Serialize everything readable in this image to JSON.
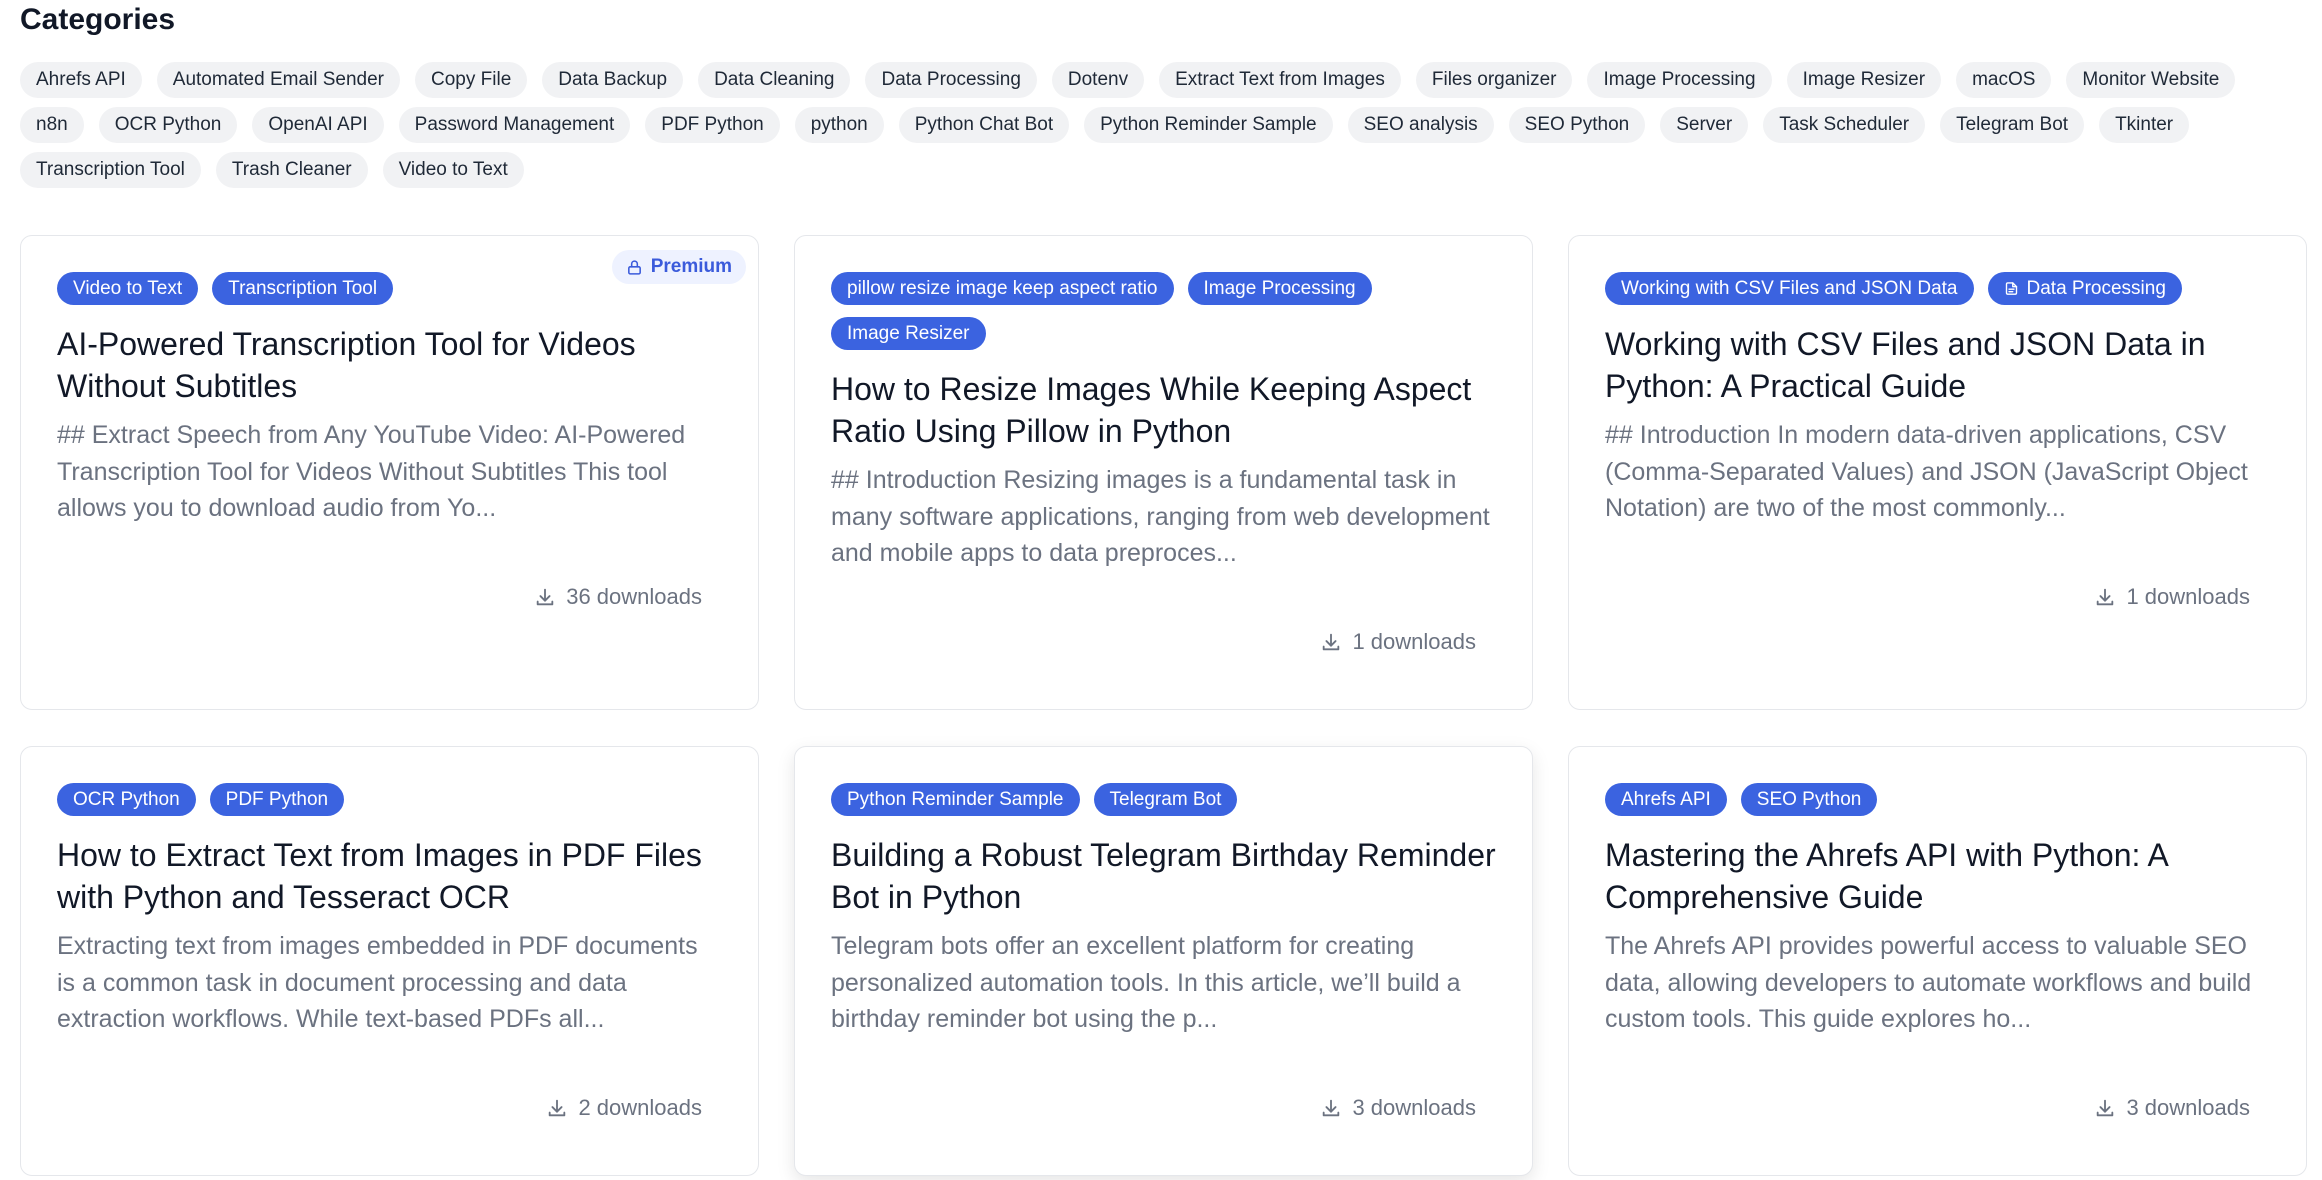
{
  "categories": {
    "title": "Categories",
    "items": [
      "Ahrefs API",
      "Automated Email Sender",
      "Copy File",
      "Data Backup",
      "Data Cleaning",
      "Data Processing",
      "Dotenv",
      "Extract Text from Images",
      "Files organizer",
      "Image Processing",
      "Image Resizer",
      "macOS",
      "Monitor Website",
      "n8n",
      "OCR Python",
      "OpenAI API",
      "Password Management",
      "PDF Python",
      "python",
      "Python Chat Bot",
      "Python Reminder Sample",
      "SEO analysis",
      "SEO Python",
      "Server",
      "Task Scheduler",
      "Telegram Bot",
      "Tkinter",
      "Transcription Tool",
      "Trash Cleaner",
      "Video to Text"
    ]
  },
  "cards": [
    {
      "tags": [
        "Video to Text",
        "Transcription Tool"
      ],
      "premium": "Premium",
      "title": "AI-Powered Transcription Tool for Videos Without Subtitles",
      "excerpt": "## Extract Speech from Any YouTube Video: AI-Powered Transcription Tool for Videos Without Subtitles This tool allows you to download audio from Yo...",
      "downloads": "36 downloads"
    },
    {
      "tags": [
        "pillow resize image keep aspect ratio",
        "Image Processing",
        "Image Resizer"
      ],
      "title": "How to Resize Images While Keeping Aspect Ratio Using Pillow in Python",
      "excerpt": "## Introduction Resizing images is a fundamental task in many software applications, ranging from web development and mobile apps to data preproces...",
      "downloads": "1 downloads"
    },
    {
      "tags": [
        "Working with CSV Files and JSON Data",
        "Data Processing"
      ],
      "title": "Working with CSV Files and JSON Data in Python: A Practical Guide",
      "excerpt": "## Introduction In modern data-driven applications, CSV (Comma-Separated Values) and JSON (JavaScript Object Notation) are two of the most commonly...",
      "downloads": "1 downloads"
    },
    {
      "tags": [
        "OCR Python",
        "PDF Python"
      ],
      "title": "How to Extract Text from Images in PDF Files with Python and Tesseract OCR",
      "excerpt": "Extracting text from images embedded in PDF documents is a common task in document processing and data extraction workflows. While text-based PDFs all...",
      "downloads": "2 downloads"
    },
    {
      "tags": [
        "Python Reminder Sample",
        "Telegram Bot"
      ],
      "title": "Building a Robust Telegram Birthday Reminder Bot in Python",
      "excerpt": "Telegram bots offer an excellent platform for creating personalized automation tools. In this article, we’ll build a birthday reminder bot using the p...",
      "downloads": "3 downloads"
    },
    {
      "tags": [
        "Ahrefs API",
        "SEO Python"
      ],
      "title": "Mastering the Ahrefs API with Python: A Comprehensive Guide",
      "excerpt": "The Ahrefs API provides powerful access to valuable SEO data, allowing developers to automate workflows and build custom tools. This guide explores ho...",
      "downloads": "3 downloads"
    }
  ],
  "icons": {
    "premium": "lock-icon",
    "downloads": "download-icon",
    "tag_data_processing": "document-icon"
  },
  "colors": {
    "tag_bg": "#3b63e0",
    "chip_bg": "#f1f2f4",
    "premium_bg": "#eef2ff",
    "premium_text": "#3b5bdb"
  }
}
